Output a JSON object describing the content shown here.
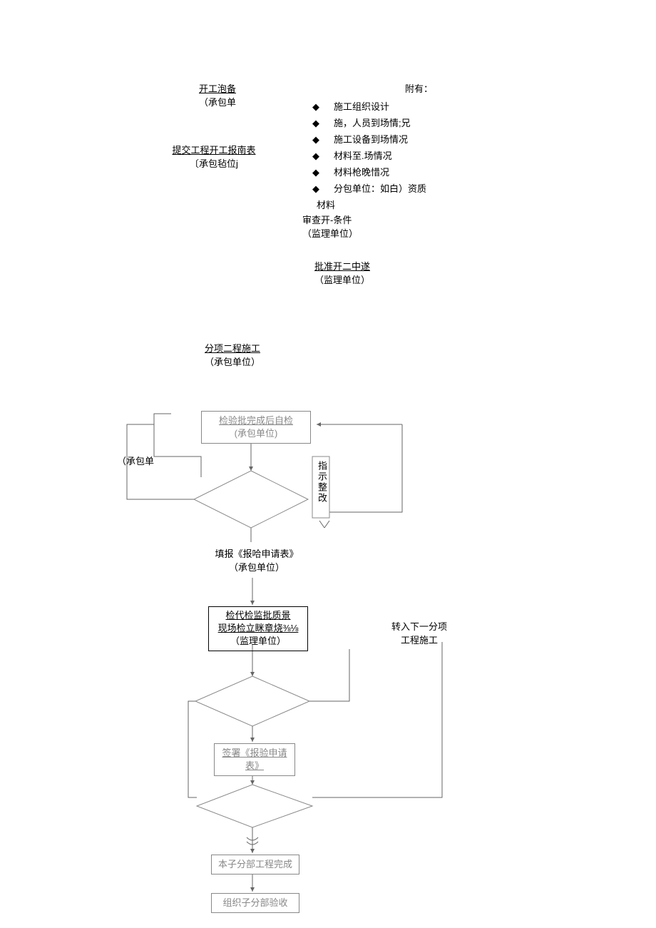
{
  "top_left_1": {
    "title": "开工泡备",
    "sub": "（承包单"
  },
  "top_left_2": {
    "title": "提交工程开工报南表",
    "sub": "〔承包毡位j"
  },
  "attach": {
    "header": "附有：",
    "items": [
      "施工组织设计",
      "施，人员到场情;兄",
      "施工设备到场情况",
      "材料至.场情况",
      "材料枪晚惜况",
      "分包单位：如白）资质"
    ],
    "material": "材料",
    "review": "审查开-条件",
    "review_sub": "（监理单位）"
  },
  "approve": {
    "title": "批准开二中遂",
    "sub": "（监理单位）"
  },
  "subwork": {
    "title": "分项二程施工",
    "sub": "（承包单位）"
  },
  "label_contractor": "（承包单",
  "box_selfcheck": {
    "title": "检验批完成后自检",
    "sub": "(承包单位)"
  },
  "side_zhishi": "指示整改",
  "after_diamond1": {
    "title": "填报《报哈申请表》",
    "sub": "（承包单位）"
  },
  "box_inspect": {
    "l1": "检代检监批质景",
    "l2": "现场检立眯章烧⅜⅛",
    "l3": "（监理单位）"
  },
  "next_sub": {
    "l1": "转入下一分项",
    "l2": "工程施工"
  },
  "box_sign": {
    "l1": "签署《报验申请",
    "l2": "表》"
  },
  "box_done": "本子分部工程完成",
  "box_organize": "组织子分部验收",
  "sym": {
    "diamond": "◆"
  }
}
